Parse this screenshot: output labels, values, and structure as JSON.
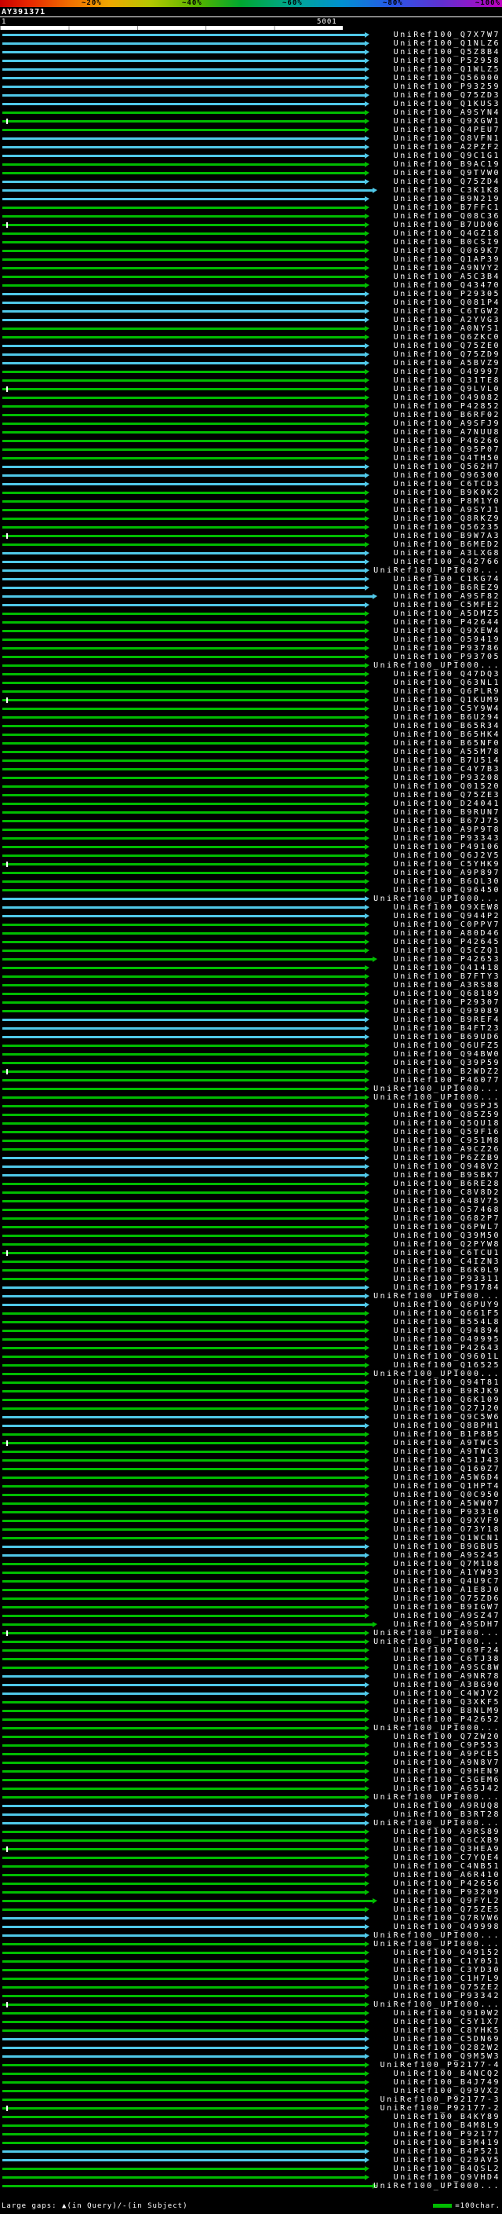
{
  "scale_bar": {
    "labels": [
      "~20%",
      "~40%",
      "~60%",
      "~80%",
      "~100%"
    ]
  },
  "query": {
    "name": "AY391371",
    "start_label": "1",
    "end_label": "5001"
  },
  "legend": {
    "gaps_text": "Large gaps: ▲(in Query)/-(in Subject)",
    "scale_text": "=100char.",
    "scale_color": "#00bc00"
  },
  "colors": {
    "green": "#00bc00",
    "cyan": "#50c8e8"
  },
  "rows": [
    {
      "label": "UniRef100_Q7X7W7",
      "c": "cyan"
    },
    {
      "label": "UniRef100_Q1NLZ6",
      "c": "cyan"
    },
    {
      "label": "UniRef100_Q5Z8B4",
      "c": "cyan"
    },
    {
      "label": "UniRef100_P52958",
      "c": "cyan"
    },
    {
      "label": "UniRef100_Q1WLZ5",
      "c": "cyan"
    },
    {
      "label": "UniRef100_Q56000",
      "c": "cyan"
    },
    {
      "label": "UniRef100_P93259",
      "c": "cyan"
    },
    {
      "label": "UniRef100_Q75ZD3",
      "c": "cyan"
    },
    {
      "label": "UniRef100_Q1KUS3",
      "c": "cyan"
    },
    {
      "label": "UniRef100_A9SYN4",
      "c": "green"
    },
    {
      "label": "UniRef100_Q9XGW1",
      "c": "green",
      "m": 1
    },
    {
      "label": "UniRef100_Q4PEU7",
      "c": "green"
    },
    {
      "label": "UniRef100_Q8VFN1",
      "c": "cyan"
    },
    {
      "label": "UniRef100_A2PZF2",
      "c": "cyan"
    },
    {
      "label": "UniRef100_Q9C1G1",
      "c": "cyan"
    },
    {
      "label": "UniRef100_B9AC19",
      "c": "green"
    },
    {
      "label": "UniRef100_Q9TVW0",
      "c": "green"
    },
    {
      "label": "UniRef100_Q75ZD4",
      "c": "cyan"
    },
    {
      "label": "UniRef100_C3K1K8",
      "c": "cyan",
      "l": 1
    },
    {
      "label": "UniRef100_B9N219",
      "c": "cyan"
    },
    {
      "label": "UniRef100_B7FFC1",
      "c": "green"
    },
    {
      "label": "UniRef100_Q08C36",
      "c": "green"
    },
    {
      "label": "UniRef100_B7UD06",
      "c": "green",
      "m": 1
    },
    {
      "label": "UniRef100_Q4GZ18",
      "c": "green"
    },
    {
      "label": "UniRef100_B0CSI9",
      "c": "green"
    },
    {
      "label": "UniRef100_Q069K7",
      "c": "green"
    },
    {
      "label": "UniRef100_Q1AP39",
      "c": "green"
    },
    {
      "label": "UniRef100_A9NVY2",
      "c": "green"
    },
    {
      "label": "UniRef100_A5C3B4",
      "c": "green"
    },
    {
      "label": "UniRef100_Q43470",
      "c": "green"
    },
    {
      "label": "UniRef100_P29305",
      "c": "cyan"
    },
    {
      "label": "UniRef100_Q081P4",
      "c": "cyan"
    },
    {
      "label": "UniRef100_C6TGW2",
      "c": "cyan"
    },
    {
      "label": "UniRef100_A2YVG3",
      "c": "cyan"
    },
    {
      "label": "UniRef100_A0NYS1",
      "c": "green"
    },
    {
      "label": "UniRef100_Q6ZKC0",
      "c": "green"
    },
    {
      "label": "UniRef100_Q75ZE0",
      "c": "cyan"
    },
    {
      "label": "UniRef100_Q75ZD9",
      "c": "cyan"
    },
    {
      "label": "UniRef100_A5BVZ9",
      "c": "cyan"
    },
    {
      "label": "UniRef100_O49997",
      "c": "green"
    },
    {
      "label": "UniRef100_Q31TE8",
      "c": "green"
    },
    {
      "label": "UniRef100_Q9LVL0",
      "c": "green",
      "m": 1
    },
    {
      "label": "UniRef100_O49082",
      "c": "green"
    },
    {
      "label": "UniRef100_P42852",
      "c": "green"
    },
    {
      "label": "UniRef100_B6RF02",
      "c": "green"
    },
    {
      "label": "UniRef100_A9SFJ9",
      "c": "green"
    },
    {
      "label": "UniRef100_A7NUU8",
      "c": "green"
    },
    {
      "label": "UniRef100_P46266",
      "c": "green"
    },
    {
      "label": "UniRef100_Q95P07",
      "c": "green"
    },
    {
      "label": "UniRef100_Q4TH50",
      "c": "green"
    },
    {
      "label": "UniRef100_Q562H7",
      "c": "cyan"
    },
    {
      "label": "UniRef100_Q96300",
      "c": "cyan"
    },
    {
      "label": "UniRef100_C6TCD3",
      "c": "cyan"
    },
    {
      "label": "UniRef100_B9K0K2",
      "c": "green"
    },
    {
      "label": "UniRef100_P8M1Y0",
      "c": "green"
    },
    {
      "label": "UniRef100_A9SYJ1",
      "c": "green"
    },
    {
      "label": "UniRef100_Q8RKZ9",
      "c": "green"
    },
    {
      "label": "UniRef100_Q56235",
      "c": "green"
    },
    {
      "label": "UniRef100_B9W7A3",
      "c": "green",
      "m": 1
    },
    {
      "label": "UniRef100_B6MED2",
      "c": "green"
    },
    {
      "label": "UniRef100_A3LXG8",
      "c": "cyan"
    },
    {
      "label": "UniRef100_Q42766",
      "c": "cyan"
    },
    {
      "label": "UniRef100_UPI000...",
      "c": "cyan"
    },
    {
      "label": "UniRef100_C1KG74",
      "c": "cyan"
    },
    {
      "label": "UniRef100_B6REZ9",
      "c": "cyan"
    },
    {
      "label": "UniRef100_A9SF82",
      "c": "cyan",
      "l": 1
    },
    {
      "label": "UniRef100_C5MFE2",
      "c": "cyan"
    },
    {
      "label": "UniRef100_A5DMZ5",
      "c": "green"
    },
    {
      "label": "UniRef100_P42644",
      "c": "green"
    },
    {
      "label": "UniRef100_Q9XEW4",
      "c": "green"
    },
    {
      "label": "UniRef100_O59419",
      "c": "green"
    },
    {
      "label": "UniRef100_P93786",
      "c": "green"
    },
    {
      "label": "UniRef100_P93705",
      "c": "green"
    },
    {
      "label": "UniRef100_UPI000...",
      "c": "green"
    },
    {
      "label": "UniRef100_Q47DQ3",
      "c": "green"
    },
    {
      "label": "UniRef100_Q63NL1",
      "c": "green"
    },
    {
      "label": "UniRef100_Q6PLR9",
      "c": "green"
    },
    {
      "label": "UniRef100_Q1KUM9",
      "c": "green",
      "m": 1
    },
    {
      "label": "UniRef100_C5Y9W4",
      "c": "green"
    },
    {
      "label": "UniRef100_B6U294",
      "c": "green"
    },
    {
      "label": "UniRef100_B65R34",
      "c": "green"
    },
    {
      "label": "UniRef100_B65HK4",
      "c": "green"
    },
    {
      "label": "UniRef100_B65NF0",
      "c": "green"
    },
    {
      "label": "UniRef100_A55M78",
      "c": "green"
    },
    {
      "label": "UniRef100_B7U514",
      "c": "green"
    },
    {
      "label": "UniRef100_C4Y7B3",
      "c": "green"
    },
    {
      "label": "UniRef100_P93208",
      "c": "green"
    },
    {
      "label": "UniRef100_Q01520",
      "c": "green"
    },
    {
      "label": "UniRef100_Q75ZE3",
      "c": "green"
    },
    {
      "label": "UniRef100_D24041",
      "c": "green"
    },
    {
      "label": "UniRef100_B9RUN7",
      "c": "green"
    },
    {
      "label": "UniRef100_B67J75",
      "c": "green"
    },
    {
      "label": "UniRef100_A9P9T8",
      "c": "green"
    },
    {
      "label": "UniRef100_P93343",
      "c": "green"
    },
    {
      "label": "UniRef100_P49106",
      "c": "green"
    },
    {
      "label": "UniRef100_Q6J2V5",
      "c": "green"
    },
    {
      "label": "UniRef100_C5YHK9",
      "c": "green",
      "m": 1
    },
    {
      "label": "UniRef100_A9P897",
      "c": "green"
    },
    {
      "label": "UniRef100_B6QL30",
      "c": "green"
    },
    {
      "label": "UniRef100_Q96450",
      "c": "green"
    },
    {
      "label": "UniRef100_UPI000...",
      "c": "cyan"
    },
    {
      "label": "UniRef100_Q9XEW8",
      "c": "cyan"
    },
    {
      "label": "UniRef100_Q944P2",
      "c": "cyan"
    },
    {
      "label": "UniRef100_C0PPV7",
      "c": "green"
    },
    {
      "label": "UniRef100_A80D46",
      "c": "green"
    },
    {
      "label": "UniRef100_P42645",
      "c": "green"
    },
    {
      "label": "UniRef100_Q5CZQ1",
      "c": "green"
    },
    {
      "label": "UniRef100_P42653",
      "c": "green",
      "l": 1
    },
    {
      "label": "UniRef100_Q41418",
      "c": "green"
    },
    {
      "label": "UniRef100_B7FTY3",
      "c": "green"
    },
    {
      "label": "UniRef100_A3RS88",
      "c": "green"
    },
    {
      "label": "UniRef100_Q68189",
      "c": "green"
    },
    {
      "label": "UniRef100_P29307",
      "c": "green"
    },
    {
      "label": "UniRef100_Q99089",
      "c": "green"
    },
    {
      "label": "UniRef100_B9REF4",
      "c": "cyan"
    },
    {
      "label": "UniRef100_B4FT23",
      "c": "cyan"
    },
    {
      "label": "UniRef100_B69UD6",
      "c": "cyan"
    },
    {
      "label": "UniRef100_Q6UFZ5",
      "c": "green"
    },
    {
      "label": "UniRef100_Q94BW0",
      "c": "green"
    },
    {
      "label": "UniRef100_Q39P59",
      "c": "green"
    },
    {
      "label": "UniRef100_B2WDZ2",
      "c": "green",
      "m": 1
    },
    {
      "label": "UniRef100_P46077",
      "c": "green"
    },
    {
      "label": "UniRef100_UPI000...",
      "c": "green"
    },
    {
      "label": "UniRef100_UPI000...",
      "c": "green"
    },
    {
      "label": "UniRef100_Q9SPJ5",
      "c": "green"
    },
    {
      "label": "UniRef100_Q85Z59",
      "c": "green"
    },
    {
      "label": "UniRef100_Q5QU18",
      "c": "green"
    },
    {
      "label": "UniRef100_Q59F16",
      "c": "green"
    },
    {
      "label": "UniRef100_C951M8",
      "c": "green"
    },
    {
      "label": "UniRef100_A9CZ26",
      "c": "green"
    },
    {
      "label": "UniRef100_P6ZZB9",
      "c": "cyan"
    },
    {
      "label": "UniRef100_Q948V2",
      "c": "cyan"
    },
    {
      "label": "UniRef100_B9SBK7",
      "c": "cyan"
    },
    {
      "label": "UniRef100_B6RE28",
      "c": "green"
    },
    {
      "label": "UniRef100_C8V8D2",
      "c": "green"
    },
    {
      "label": "UniRef100_A48V75",
      "c": "green"
    },
    {
      "label": "UniRef100_O57468",
      "c": "green"
    },
    {
      "label": "UniRef100_Q682P7",
      "c": "green"
    },
    {
      "label": "UniRef100_Q6PWL7",
      "c": "green"
    },
    {
      "label": "UniRef100_Q39M50",
      "c": "green"
    },
    {
      "label": "UniRef100_Q2PYW8",
      "c": "green"
    },
    {
      "label": "UniRef100_C6TCU1",
      "c": "green",
      "m": 1
    },
    {
      "label": "UniRef100_C4IZN3",
      "c": "green"
    },
    {
      "label": "UniRef100_B6K0L9",
      "c": "green"
    },
    {
      "label": "UniRef100_P93311",
      "c": "green"
    },
    {
      "label": "UniRef100_P91784",
      "c": "cyan"
    },
    {
      "label": "UniRef100_UPI000...",
      "c": "cyan"
    },
    {
      "label": "UniRef100_Q6PUY9",
      "c": "cyan"
    },
    {
      "label": "UniRef100_Q661F5",
      "c": "green"
    },
    {
      "label": "UniRef100_B554L8",
      "c": "green"
    },
    {
      "label": "UniRef100_Q94894",
      "c": "green"
    },
    {
      "label": "UniRef100_O49995",
      "c": "green"
    },
    {
      "label": "UniRef100_P42643",
      "c": "green"
    },
    {
      "label": "UniRef100_Q9601L",
      "c": "green"
    },
    {
      "label": "UniRef100_Q16525",
      "c": "green"
    },
    {
      "label": "UniRef100_UPI000...",
      "c": "green"
    },
    {
      "label": "UniRef100_Q94T81",
      "c": "green"
    },
    {
      "label": "UniRef100_B9RJK9",
      "c": "green"
    },
    {
      "label": "UniRef100_Q6K109",
      "c": "green"
    },
    {
      "label": "UniRef100_Q27J20",
      "c": "green"
    },
    {
      "label": "UniRef100_Q9C5W6",
      "c": "cyan"
    },
    {
      "label": "UniRef100_Q8BPH1",
      "c": "cyan"
    },
    {
      "label": "UniRef100_B1P8B5",
      "c": "green"
    },
    {
      "label": "UniRef100_A9TWC5",
      "c": "green",
      "m": 1
    },
    {
      "label": "UniRef100_A9TWC3",
      "c": "green"
    },
    {
      "label": "UniRef100_A51J43",
      "c": "green"
    },
    {
      "label": "UniRef100_Q160Z7",
      "c": "green"
    },
    {
      "label": "UniRef100_A5W6D4",
      "c": "green"
    },
    {
      "label": "UniRef100_Q1HPT4",
      "c": "green"
    },
    {
      "label": "UniRef100_Q0C950",
      "c": "green"
    },
    {
      "label": "UniRef100_A5WW07",
      "c": "green"
    },
    {
      "label": "UniRef100_P93310",
      "c": "green"
    },
    {
      "label": "UniRef100_Q9XVF9",
      "c": "green"
    },
    {
      "label": "UniRef100_O73Y18",
      "c": "green"
    },
    {
      "label": "UniRef100_Q1WCN1",
      "c": "green"
    },
    {
      "label": "UniRef100_B9GBU5",
      "c": "cyan"
    },
    {
      "label": "UniRef100_A9S245",
      "c": "cyan"
    },
    {
      "label": "UniRef100_Q7M1D8",
      "c": "green"
    },
    {
      "label": "UniRef100_A1YW93",
      "c": "green"
    },
    {
      "label": "UniRef100_Q4U9C7",
      "c": "green"
    },
    {
      "label": "UniRef100_A1E8J0",
      "c": "green"
    },
    {
      "label": "UniRef100_Q75ZD6",
      "c": "green"
    },
    {
      "label": "UniRef100_B9IGW7",
      "c": "green"
    },
    {
      "label": "UniRef100_A9SZ47",
      "c": "green"
    },
    {
      "label": "UniRef100_A9SDH7",
      "c": "green",
      "l": 1
    },
    {
      "label": "UniRef100_UPI000...",
      "c": "green",
      "m": 1
    },
    {
      "label": "UniRef100_UPI000...",
      "c": "green"
    },
    {
      "label": "UniRef100_Q69F24",
      "c": "green"
    },
    {
      "label": "UniRef100_C6TJ38",
      "c": "green"
    },
    {
      "label": "UniRef100_A9SC8W",
      "c": "green"
    },
    {
      "label": "UniRef100_A9NR78",
      "c": "cyan"
    },
    {
      "label": "UniRef100_A3BG90",
      "c": "cyan"
    },
    {
      "label": "UniRef100_C4WJV2",
      "c": "cyan"
    },
    {
      "label": "UniRef100_Q3XKF5",
      "c": "green"
    },
    {
      "label": "UniRef100_B8NLM9",
      "c": "green"
    },
    {
      "label": "UniRef100_P42652",
      "c": "green"
    },
    {
      "label": "UniRef100_UPI000...",
      "c": "green"
    },
    {
      "label": "UniRef100_Q7ZW20",
      "c": "green"
    },
    {
      "label": "UniRef100_C9P553",
      "c": "green"
    },
    {
      "label": "UniRef100_A9PCE5",
      "c": "green"
    },
    {
      "label": "UniRef100_A9N8V7",
      "c": "green"
    },
    {
      "label": "UniRef100_Q9HEN9",
      "c": "green"
    },
    {
      "label": "UniRef100_C5GEM6",
      "c": "green"
    },
    {
      "label": "UniRef100_A65J42",
      "c": "green"
    },
    {
      "label": "UniRef100_UPI000...",
      "c": "green"
    },
    {
      "label": "UniRef100_A9RUQ8",
      "c": "cyan"
    },
    {
      "label": "UniRef100_B3RT28",
      "c": "cyan"
    },
    {
      "label": "UniRef100_UPI000...",
      "c": "cyan"
    },
    {
      "label": "UniRef100_A9RS89",
      "c": "green"
    },
    {
      "label": "UniRef100_Q6CXB9",
      "c": "green"
    },
    {
      "label": "UniRef100_Q3HEA9",
      "c": "green",
      "m": 1
    },
    {
      "label": "UniRef100_C7YQE4",
      "c": "green"
    },
    {
      "label": "UniRef100_C4NB51",
      "c": "green"
    },
    {
      "label": "UniRef100_A6R410",
      "c": "green"
    },
    {
      "label": "UniRef100_P42656",
      "c": "green"
    },
    {
      "label": "UniRef100_P93209",
      "c": "green"
    },
    {
      "label": "UniRef100_Q9FYL2",
      "c": "green",
      "l": 1
    },
    {
      "label": "UniRef100_Q75ZE5",
      "c": "green"
    },
    {
      "label": "UniRef100_Q7RVW6",
      "c": "cyan"
    },
    {
      "label": "UniRef100_O49998",
      "c": "cyan"
    },
    {
      "label": "UniRef100_UPI000...",
      "c": "cyan"
    },
    {
      "label": "UniRef100_UPI000...",
      "c": "green"
    },
    {
      "label": "UniRef100_O49152",
      "c": "green"
    },
    {
      "label": "UniRef100_C1Y051",
      "c": "green"
    },
    {
      "label": "UniRef100_C3YD30",
      "c": "green"
    },
    {
      "label": "UniRef100_C1H7L9",
      "c": "green"
    },
    {
      "label": "UniRef100_Q75ZE2",
      "c": "green"
    },
    {
      "label": "UniRef100_P93342",
      "c": "green"
    },
    {
      "label": "UniRef100_UPI000...",
      "c": "green",
      "m": 1
    },
    {
      "label": "UniRef100_Q910W2",
      "c": "green"
    },
    {
      "label": "UniRef100_C5Y1X7",
      "c": "green"
    },
    {
      "label": "UniRef100_C8YHK5",
      "c": "green"
    },
    {
      "label": "UniRef100_C5DN69",
      "c": "cyan"
    },
    {
      "label": "UniRef100_Q282W2",
      "c": "cyan"
    },
    {
      "label": "UniRef100_Q9M5W3",
      "c": "cyan"
    },
    {
      "label": "UniRef100_P92177-4",
      "c": "green"
    },
    {
      "label": "UniRef100_B4NCQ2",
      "c": "green"
    },
    {
      "label": "UniRef100_B4J749",
      "c": "green"
    },
    {
      "label": "UniRef100_Q99VX2",
      "c": "green"
    },
    {
      "label": "UniRef100_P92177-3",
      "c": "green"
    },
    {
      "label": "UniRef100_P92177-2",
      "c": "green",
      "m": 1
    },
    {
      "label": "UniRef100_B4KY89",
      "c": "green"
    },
    {
      "label": "UniRef100_B4M8L9",
      "c": "green"
    },
    {
      "label": "UniRef100_P92177",
      "c": "green"
    },
    {
      "label": "UniRef100_B3M419",
      "c": "green"
    },
    {
      "label": "UniRef100_B4P521",
      "c": "cyan"
    },
    {
      "label": "UniRef100_Q29AV5",
      "c": "cyan"
    },
    {
      "label": "UniRef100_B4QSL2",
      "c": "green"
    },
    {
      "label": "UniRef100_Q9VHD4",
      "c": "green"
    },
    {
      "label": "UniRef100_UPI000...",
      "c": "green",
      "l": 1
    }
  ]
}
